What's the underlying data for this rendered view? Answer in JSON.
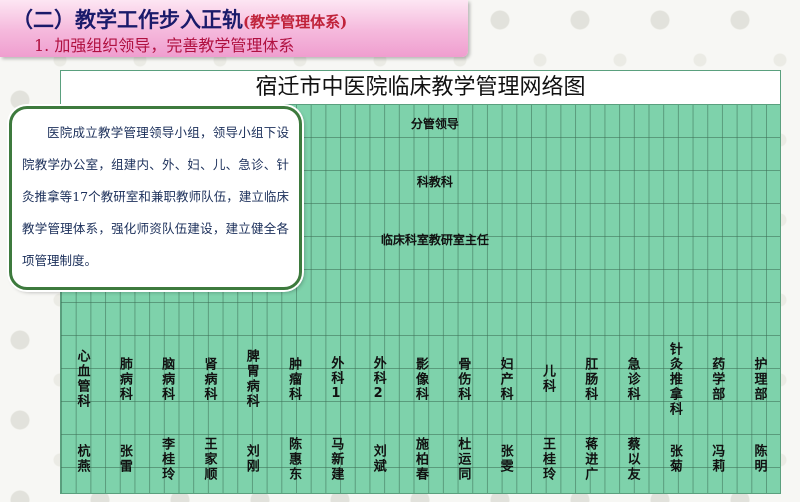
{
  "header": {
    "title": "（二）教学工作步入正轨",
    "title_note": "(教学管理体系)",
    "subtitle": "1. 加强组织领导，完善教学管理体系"
  },
  "chart": {
    "title": "宿迁市中医院临床教学管理网络图",
    "levels": [
      "分管领导",
      "科教科",
      "临床科室教研室主任"
    ],
    "departments": [
      "心血管科",
      "肺病科",
      "脑病科",
      "肾病科",
      "脾胃病科",
      "肿瘤科",
      "外科1",
      "外科2",
      "影像科",
      "骨伤科",
      "妇产科",
      "儿科",
      "肛肠科",
      "急诊科",
      "针灸推拿科",
      "药学部",
      "护理部"
    ],
    "heads": [
      "杭燕",
      "张雷",
      "李桂玲",
      "王家顺",
      "刘刚",
      "陈惠东",
      "马新建",
      "刘斌",
      "施柏春",
      "杜运同",
      "张雯",
      "王桂玲",
      "蒋进广",
      "蔡以友",
      "张菊",
      "冯莉",
      "陈明"
    ]
  },
  "info_box": {
    "text": "医院成立教学管理领导小组，领导小组下设院教学办公室，组建内、外、妇、儿、急诊、针灸推拿等17个教研室和兼职教师队伍，建立临床教学管理体系，强化师资队伍建设，建立健全各项管理制度。"
  },
  "colors": {
    "header_bg": "#f5b8dc",
    "title_text": "#1a1a6a",
    "subtitle_text": "#b01040",
    "chart_green": "#7ed2ab",
    "box_border": "#3d7a3d"
  }
}
